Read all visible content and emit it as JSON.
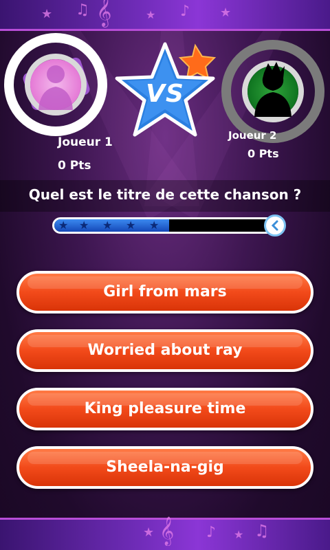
{
  "players": [
    {
      "name": "Joueur 1",
      "score": "0 Pts"
    },
    {
      "name": "Joueur 2",
      "score": "0 Pts"
    }
  ],
  "vs_label": "VS",
  "question": "Quel est le titre de cette chanson ?",
  "timer_progress": 0.51,
  "answers": [
    {
      "label": "Girl from mars"
    },
    {
      "label": "Worried about ray"
    },
    {
      "label": "King pleasure time"
    },
    {
      "label": "Sheela-na-gig"
    }
  ],
  "colors": {
    "answer_button": "#f24a1a",
    "progress_fill": "#1548b8",
    "vs_star": "#2b7fe0",
    "player2_bg": "#0f7420",
    "player1_bg": "#e57ad6"
  },
  "icons": {
    "vs_badge": "star-icon",
    "timer": "clock-icon",
    "player_avatar": "person-silhouette-icon"
  }
}
